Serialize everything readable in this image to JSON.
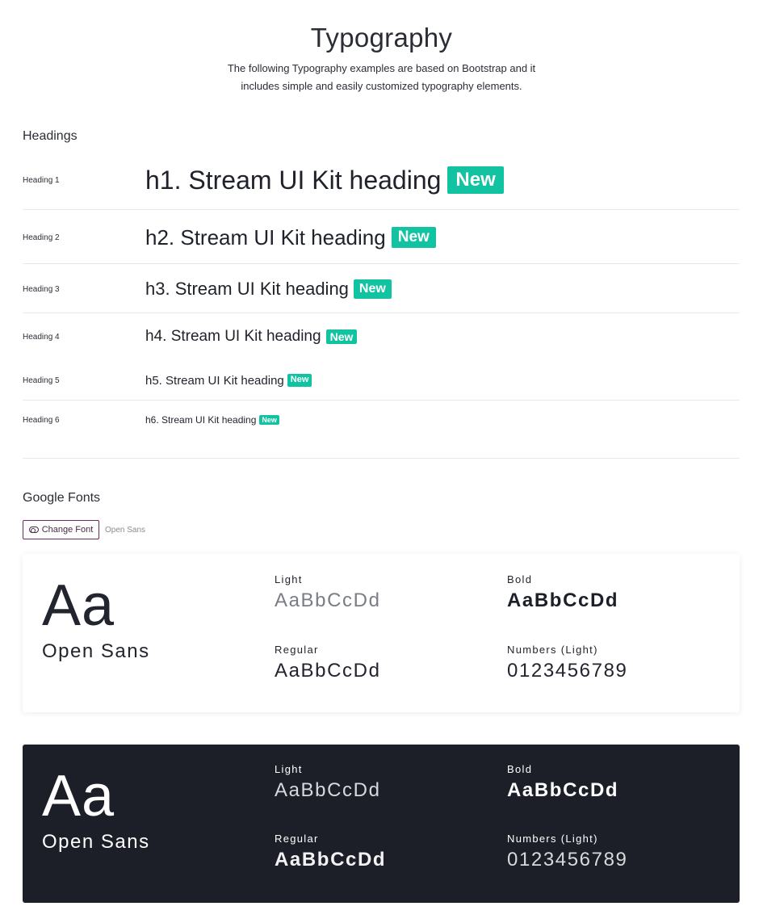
{
  "page": {
    "title": "Typography",
    "description": "The following Typography examples are based on Bootstrap and it includes simple and easily customized typography elements."
  },
  "headings_section": {
    "title": "Headings",
    "badge_text": "New",
    "rows": [
      {
        "label": "Heading 1",
        "text": "h1. Stream UI Kit heading"
      },
      {
        "label": "Heading 2",
        "text": "h2. Stream UI Kit heading"
      },
      {
        "label": "Heading 3",
        "text": "h3. Stream UI Kit heading"
      },
      {
        "label": "Heading 4",
        "text": "h4. Stream UI Kit heading"
      },
      {
        "label": "Heading 5",
        "text": "h5. Stream UI Kit heading"
      },
      {
        "label": "Heading 6",
        "text": "h6. Stream UI Kit heading"
      }
    ]
  },
  "fonts_section": {
    "title": "Google Fonts",
    "change_font_label": "Change Font",
    "current_font": "Open Sans",
    "cards": [
      {
        "theme": "light",
        "aa": "Aa",
        "family": "Open Sans",
        "light_label": "Light",
        "light_sample": "AaBbCcDd",
        "regular_label": "Regular",
        "regular_sample": "AaBbCcDd",
        "bold_label": "Bold",
        "bold_sample": "AaBbCcDd",
        "numbers_label": "Numbers (Light)",
        "numbers_sample": "0123456789"
      },
      {
        "theme": "dark",
        "aa": "Aa",
        "family": "Open Sans",
        "light_label": "Light",
        "light_sample": "AaBbCcDd",
        "regular_label": "Regular",
        "regular_sample": "AaBbCcDd",
        "bold_label": "Bold",
        "bold_sample": "AaBbCcDd",
        "numbers_label": "Numbers (Light)",
        "numbers_sample": "0123456789"
      }
    ]
  },
  "colors": {
    "badge": "#12c3a2",
    "dark_card": "#1c1f27",
    "button_border": "#6b2a5e"
  }
}
